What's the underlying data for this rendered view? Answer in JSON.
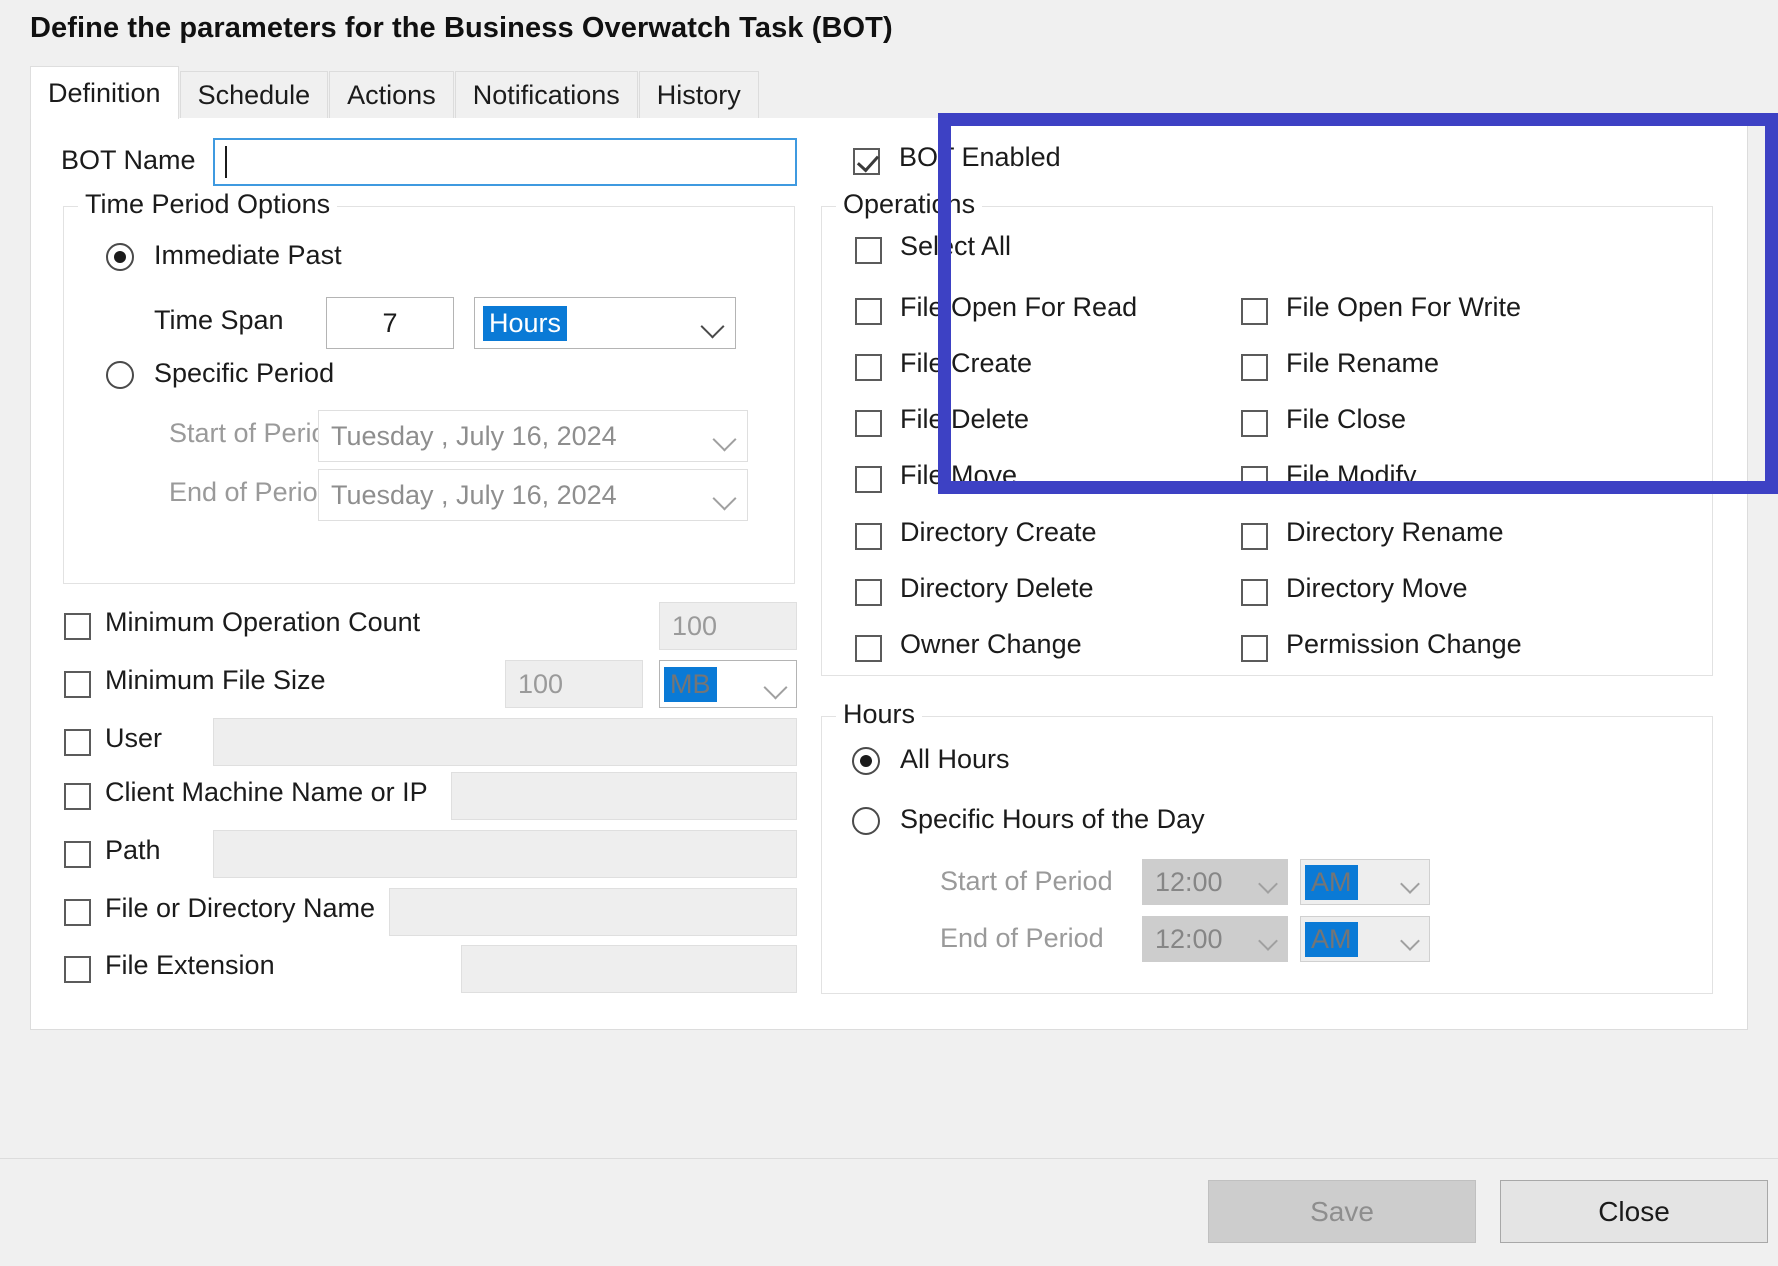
{
  "dialog": {
    "title": "Define the parameters for the Business Overwatch Task (BOT)"
  },
  "tabs": [
    {
      "label": "Definition",
      "active": true
    },
    {
      "label": "Schedule",
      "active": false
    },
    {
      "label": "Actions",
      "active": false
    },
    {
      "label": "Notifications",
      "active": false
    },
    {
      "label": "History",
      "active": false
    }
  ],
  "definition": {
    "bot_name": {
      "label": "BOT Name",
      "value": "",
      "focused": true
    },
    "time_period_options": {
      "title": "Time Period Options",
      "immediate_past": {
        "label": "Immediate Past",
        "selected": true
      },
      "time_span": {
        "label": "Time Span",
        "value": "7",
        "unit_value": "Hours",
        "unit_selected": true
      },
      "specific_period": {
        "label": "Specific Period",
        "selected": false
      },
      "start_of_period": {
        "label": "Start of Period",
        "value": "Tuesday   ,      July      16, 2024",
        "disabled": true
      },
      "end_of_period": {
        "label": "End of Period",
        "value": "Tuesday   ,      July      16, 2024",
        "disabled": true
      }
    },
    "filters": [
      {
        "label": "Minimum Operation Count",
        "checked": false,
        "value": "100"
      },
      {
        "label": "Minimum File Size",
        "checked": false,
        "value": "100",
        "unit": "MB"
      },
      {
        "label": "User",
        "checked": false,
        "value": ""
      },
      {
        "label": "Client Machine Name or IP",
        "checked": false,
        "value": ""
      },
      {
        "label": "Path",
        "checked": false,
        "value": ""
      },
      {
        "label": "File or Directory Name",
        "checked": false,
        "value": ""
      },
      {
        "label": "File Extension",
        "checked": false,
        "value": ""
      }
    ]
  },
  "right_panel": {
    "bot_enabled": {
      "label": "BOT Enabled",
      "checked": true
    },
    "operations": {
      "title": "Operations",
      "select_all": {
        "label": "Select All",
        "checked": false
      },
      "items": [
        {
          "label": "File Open For Read",
          "checked": false
        },
        {
          "label": "File Open For Write",
          "checked": false
        },
        {
          "label": "File Create",
          "checked": false
        },
        {
          "label": "File Rename",
          "checked": false
        },
        {
          "label": "File Delete",
          "checked": false
        },
        {
          "label": "File Close",
          "checked": false
        },
        {
          "label": "File Move",
          "checked": false
        },
        {
          "label": "File Modify",
          "checked": false
        },
        {
          "label": "Directory Create",
          "checked": false
        },
        {
          "label": "Directory Rename",
          "checked": false
        },
        {
          "label": "Directory Delete",
          "checked": false
        },
        {
          "label": "Directory Move",
          "checked": false
        },
        {
          "label": "Owner Change",
          "checked": false
        },
        {
          "label": "Permission Change",
          "checked": false
        }
      ]
    },
    "hours": {
      "title": "Hours",
      "all_hours": {
        "label": "All Hours",
        "selected": true
      },
      "specific_hours": {
        "label": "Specific Hours of the Day",
        "selected": false
      },
      "start_of_period": {
        "label": "Start of Period",
        "time": "12:00",
        "meridiem": "AM",
        "disabled": true
      },
      "end_of_period": {
        "label": "End of Period",
        "time": "12:00",
        "meridiem": "AM",
        "disabled": true
      }
    }
  },
  "footer": {
    "save": {
      "label": "Save",
      "enabled": false
    },
    "close": {
      "label": "Close",
      "enabled": true
    }
  },
  "highlight": {
    "color": "#3d41c4"
  }
}
